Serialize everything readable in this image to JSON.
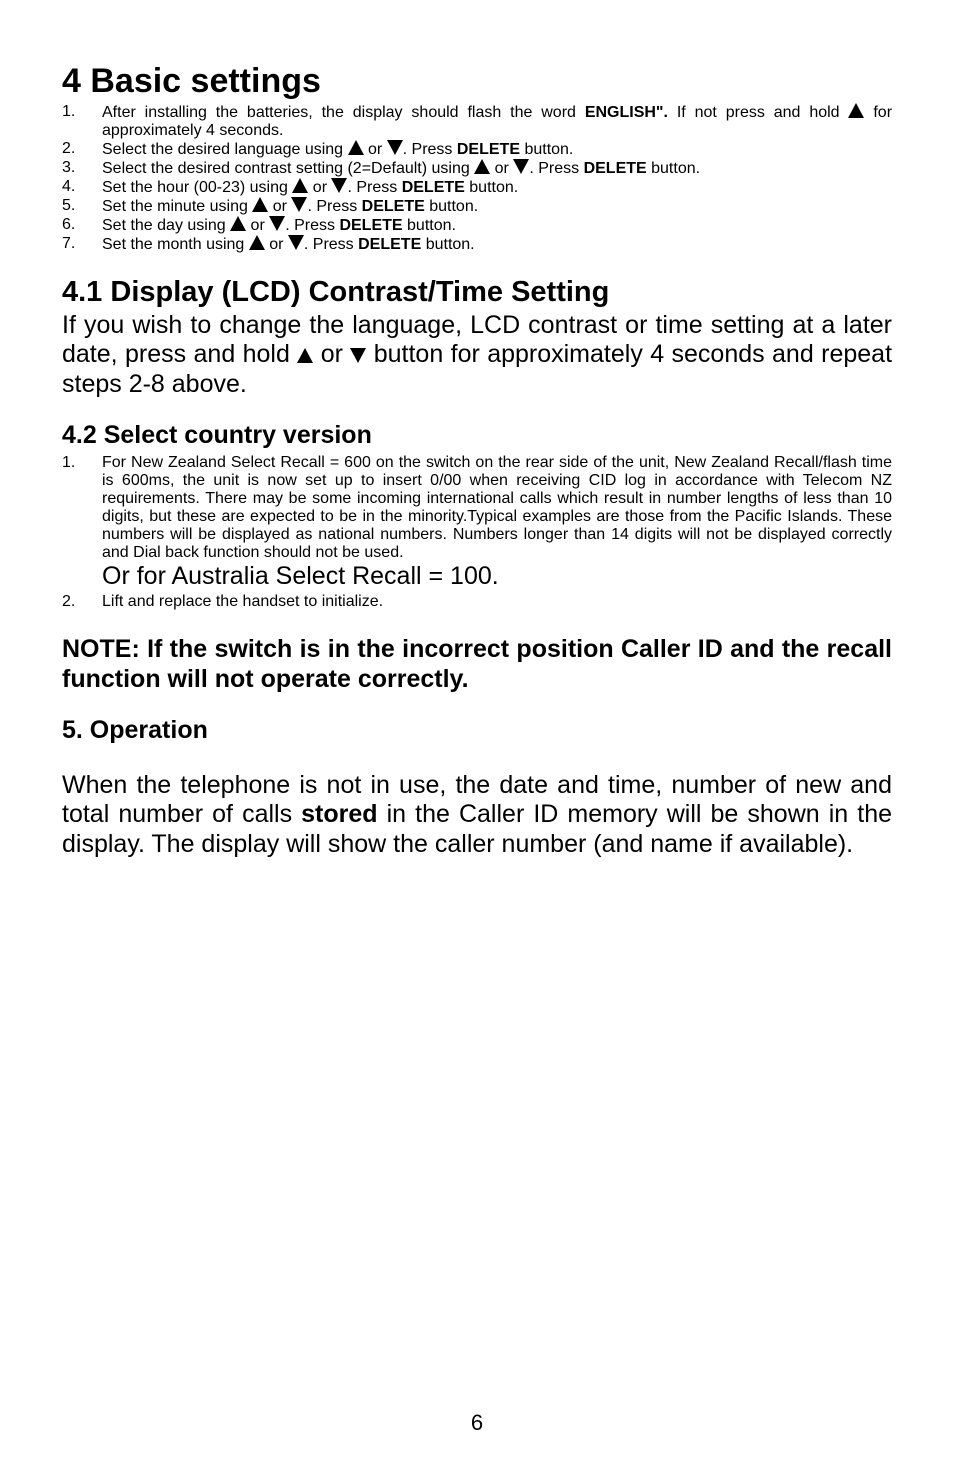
{
  "h1": "4  Basic settings",
  "s4": {
    "i1a": "After installing the batteries, the display should flash the word ",
    "i1b": "ENGLISH\".",
    "i1c": "If not press and hold ",
    "i1d": " for approximately 4 seconds.",
    "i2a": "Select the desired language using ",
    "i2b": " or ",
    "i2c": ". Press ",
    "i2d": "DELETE",
    "i2e": " button.",
    "i3a": "Select the desired contrast setting (2=Default) using ",
    "i3b": " or ",
    "i3c": ". Press ",
    "i3d": "DELETE",
    "i3e": " button.",
    "i4a": "Set the hour (00-23) using ",
    "i4b": " or ",
    "i4c": ". Press ",
    "i4d": "DELETE",
    "i4e": " button.",
    "i5a": "Set the minute using ",
    "i5b": " or ",
    "i5c": ". Press ",
    "i5d": "DELETE",
    "i5e": " button.",
    "i6a": "Set the day using ",
    "i6b": " or ",
    "i6c": ". Press ",
    "i6d": "DELETE",
    "i6e": " button.",
    "i7a": "Set the month using ",
    "i7b": " or ",
    "i7c": ". Press ",
    "i7d": "DELETE",
    "i7e": " button."
  },
  "h2_41_num": "4.1",
  "h2_41": "  Display (LCD) Contrast/Time Setting",
  "p41a": "If you wish to change the language, LCD contrast or time setting at a later date, press and hold ",
  "p41b": " or ",
  "p41c": " button for approximately 4 seconds and repeat steps 2-8 above.",
  "h3_42": "4.2  Select country version",
  "s42": {
    "i1": "For New Zealand Select Recall = 600 on the switch on the rear side of the unit,  New Zealand Recall/flash time is 600ms, the unit is now set up to insert 0/00 when receiving CID log in accordance with Telecom NZ requirements. There may be some incoming international calls which result in number lengths of less than 10 digits, but these are expected to be in the minority.Typical examples are those from the Pacific Islands. These numbers will be displayed as national numbers. Numbers longer than 14 digits will not be displayed correctly and Dial back function should not be used.",
    "i1b": "Or for Australia Select Recall = 100.",
    "i2": "Lift and replace the handset to initialize."
  },
  "note": "NOTE: If the switch is in the incorrect position Caller ID and the recall function will not operate correctly.",
  "h3_5": "5.  Operation",
  "p5a": "When the telephone is not in use, the date and time, number of new and total number of calls ",
  "p5b": "stored",
  "p5c": " in the Caller ID memory will be shown in the display. The display will show the caller number (and name if available).",
  "pagenum": "6"
}
